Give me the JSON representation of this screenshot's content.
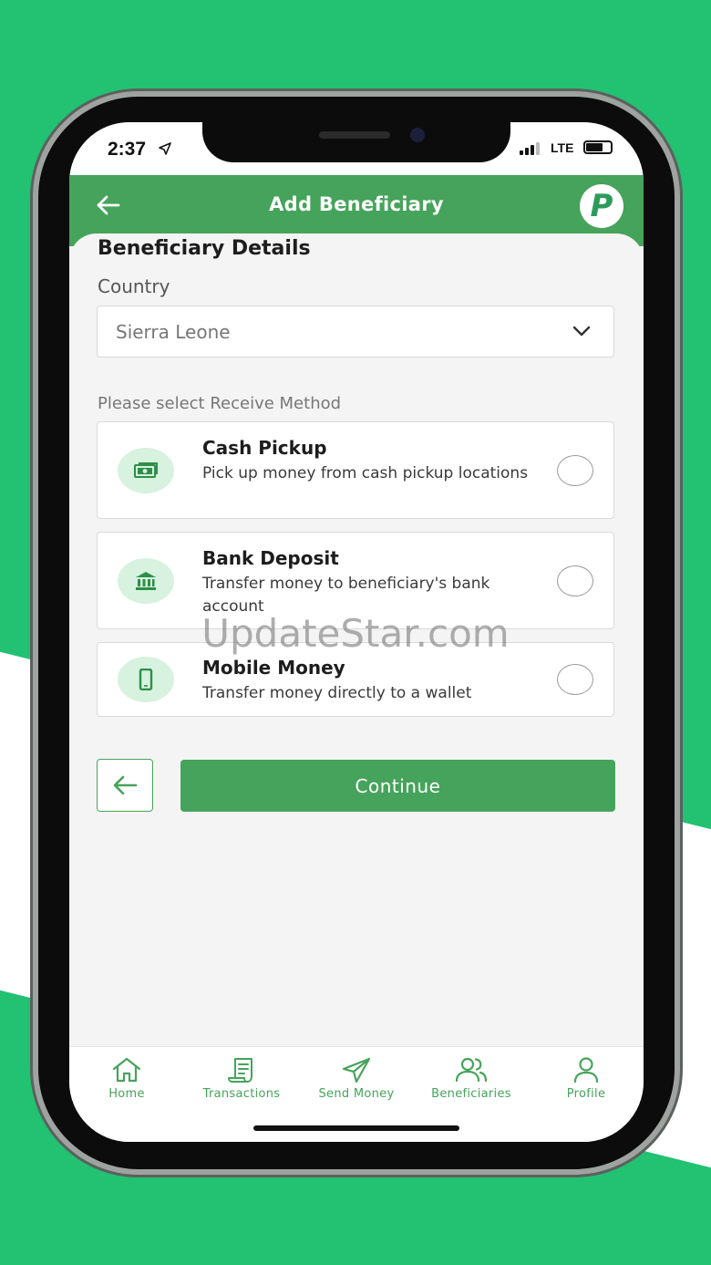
{
  "status_bar": {
    "time": "2:37",
    "network": "LTE"
  },
  "header": {
    "title": "Add Beneficiary",
    "logo_letter": "P"
  },
  "content": {
    "section_title": "Beneficiary Details",
    "country_label": "Country",
    "country_value": "Sierra Leone",
    "method_label": "Please select Receive Method"
  },
  "methods": [
    {
      "icon": "cash-icon",
      "title": "Cash Pickup",
      "description": "Pick up money from cash pickup locations",
      "selected": false
    },
    {
      "icon": "bank-icon",
      "title": "Bank Deposit",
      "description": "Transfer money to beneficiary's bank account",
      "selected": false
    },
    {
      "icon": "phone-icon",
      "title": "Mobile Money",
      "description": "Transfer money directly to a wallet",
      "selected": false
    }
  ],
  "actions": {
    "continue_label": "Continue"
  },
  "tabs": [
    {
      "label": "Home",
      "icon": "home-icon"
    },
    {
      "label": "Transactions",
      "icon": "receipt-icon"
    },
    {
      "label": "Send Money",
      "icon": "send-icon"
    },
    {
      "label": "Beneficiaries",
      "icon": "users-icon"
    },
    {
      "label": "Profile",
      "icon": "user-icon"
    }
  ],
  "watermark": "UpdateStar.com",
  "colors": {
    "brand_green": "#46a35b",
    "background_green": "#22c272",
    "icon_bg": "#d7f2df"
  }
}
